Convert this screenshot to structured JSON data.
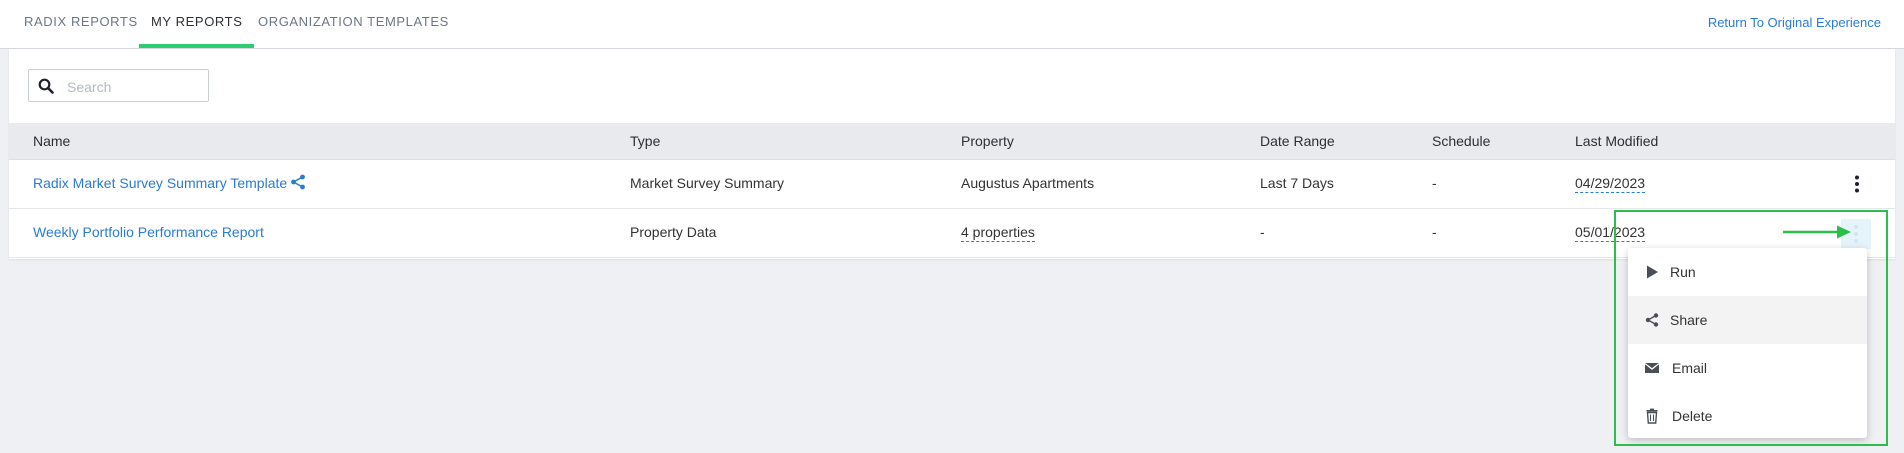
{
  "tabs": [
    {
      "label": "RADIX REPORTS",
      "active": false
    },
    {
      "label": "MY REPORTS",
      "active": true
    },
    {
      "label": "ORGANIZATION TEMPLATES",
      "active": false
    }
  ],
  "return_link": "Return To Original Experience",
  "search": {
    "placeholder": "Search",
    "value": ""
  },
  "table": {
    "columns": [
      "Name",
      "Type",
      "Property",
      "Date Range",
      "Schedule",
      "Last Modified"
    ],
    "rows": [
      {
        "name": "Radix Market Survey Summary Template",
        "shared": true,
        "type": "Market Survey Summary",
        "property": "Augustus Apartments",
        "date_range": "Last 7 Days",
        "schedule": "-",
        "last_modified": "04/29/2023"
      },
      {
        "name": "Weekly Portfolio Performance Report",
        "shared": false,
        "type": "Property Data",
        "property": "4 properties",
        "date_range": "-",
        "schedule": "-",
        "last_modified": "05/01/2023"
      }
    ]
  },
  "menu": {
    "items": [
      {
        "label": "Run",
        "icon": "play-icon"
      },
      {
        "label": "Share",
        "icon": "share-icon"
      },
      {
        "label": "Email",
        "icon": "envelope-icon"
      },
      {
        "label": "Delete",
        "icon": "trash-icon"
      }
    ]
  },
  "colors": {
    "accent": "#2ecc71",
    "link": "#2a7bd5",
    "highlight": "#2dbe4a"
  }
}
